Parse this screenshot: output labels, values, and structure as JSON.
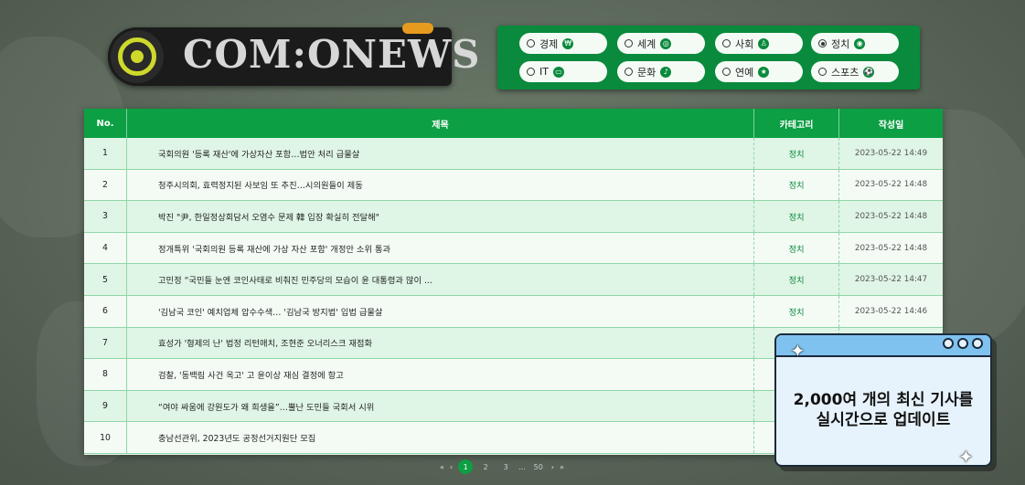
{
  "logo": {
    "text": "COM:ONEWS"
  },
  "categories": [
    {
      "label": "경제",
      "icon": "coin-icon",
      "selected": false
    },
    {
      "label": "세계",
      "icon": "globe-icon",
      "selected": false
    },
    {
      "label": "사회",
      "icon": "people-icon",
      "selected": false
    },
    {
      "label": "정치",
      "icon": "politics-icon",
      "selected": true
    },
    {
      "label": "IT",
      "icon": "computer-icon",
      "selected": false
    },
    {
      "label": "문화",
      "icon": "culture-icon",
      "selected": false
    },
    {
      "label": "연예",
      "icon": "star-icon",
      "selected": false
    },
    {
      "label": "스포츠",
      "icon": "sports-icon",
      "selected": false
    }
  ],
  "table": {
    "headers": {
      "no": "No.",
      "title": "제목",
      "category": "카테고리",
      "date": "작성일"
    },
    "rows": [
      {
        "no": "1",
        "title": "국회의원 '등록 재산'에 가상자산 포함…법안 처리 급물살",
        "category": "정치",
        "date": "2023-05-22 14:49"
      },
      {
        "no": "2",
        "title": "청주시의회, 효력정지된 사보임 또 추진…시의원들이 제동",
        "category": "정치",
        "date": "2023-05-22 14:48"
      },
      {
        "no": "3",
        "title": "박진 \"尹, 한일정상회담서 오염수 문제 韓 입장 확실히 전달해\"",
        "category": "정치",
        "date": "2023-05-22 14:48"
      },
      {
        "no": "4",
        "title": "정개특위 '국회의원 등록 재산에 가상 자산 포함' 개정안 소위 통과",
        "category": "정치",
        "date": "2023-05-22 14:48"
      },
      {
        "no": "5",
        "title": "고민정 “국민들 눈엔 코인사태로 비춰진 민주당의 모습이 윤 대통령과 많이 ...",
        "category": "정치",
        "date": "2023-05-22 14:47"
      },
      {
        "no": "6",
        "title": "'김남국 코인' 예치업체 압수수색… '김남국 방지법' 입법 급물살",
        "category": "정치",
        "date": "2023-05-22 14:46"
      },
      {
        "no": "7",
        "title": "효성가 '형제의 난' 법정 리턴매치, 조현준 오너리스크 재점화",
        "category": "",
        "date": ""
      },
      {
        "no": "8",
        "title": "검찰, '동백림 사건 옥고' 고 윤이상 재심 결정에 항고",
        "category": "",
        "date": ""
      },
      {
        "no": "9",
        "title": "“여야 싸움에 강원도가 왜 희생을”…뿔난 도민들 국회서 시위",
        "category": "",
        "date": ""
      },
      {
        "no": "10",
        "title": "충남선관위, 2023년도 공정선거지원단 모집",
        "category": "",
        "date": ""
      }
    ]
  },
  "pagination": {
    "first": "«",
    "prev": "‹",
    "pages": [
      "1",
      "2",
      "3"
    ],
    "ellipsis": "...",
    "last_page": "50",
    "next": "›",
    "last": "»",
    "current": "1"
  },
  "popup": {
    "line1": "2,000여 개의 최신 기사를",
    "line2": "실시간으로 업데이트"
  }
}
